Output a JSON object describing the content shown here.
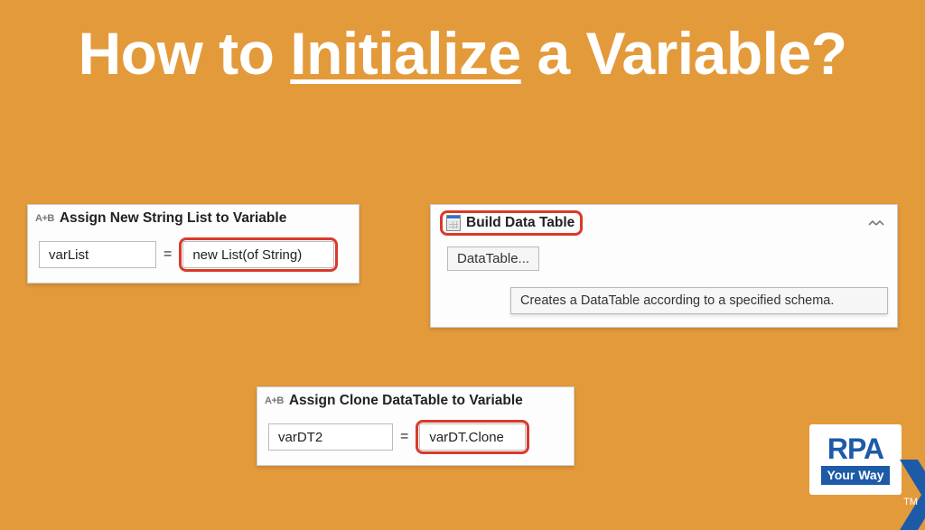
{
  "title": {
    "pre": "How to ",
    "underlined": "Initialize",
    "post": " a Variable?"
  },
  "card1": {
    "header_icon": "A+B",
    "header": "Assign New String List to Variable",
    "var": "varList",
    "eq": "=",
    "val": "new List(of String)"
  },
  "card2": {
    "title": "Build Data Table",
    "button": "DataTable...",
    "tooltip": "Creates a DataTable according to a specified schema."
  },
  "card3": {
    "header_icon": "A+B",
    "header": "Assign Clone DataTable to Variable",
    "var": "varDT2",
    "eq": "=",
    "val": "varDT.Clone"
  },
  "logo": {
    "rpa": "RPA",
    "your_way": "Your Way",
    "tm": "TM"
  }
}
